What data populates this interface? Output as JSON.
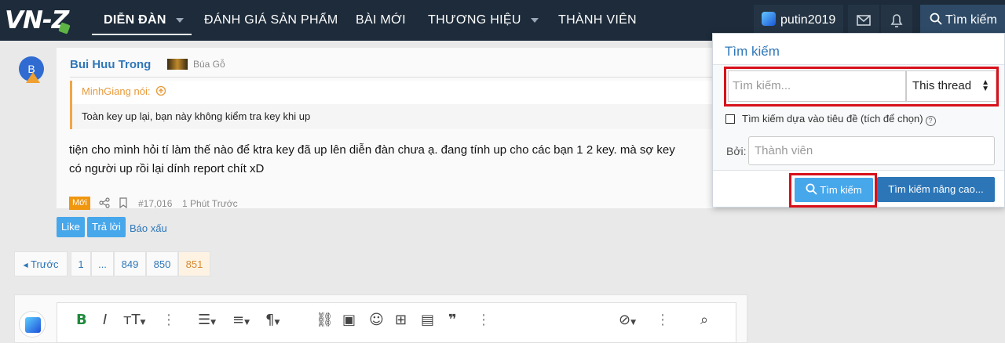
{
  "header": {
    "logo_text": "VN-Z",
    "nav": [
      {
        "label": "DIỄN ĐÀN"
      },
      {
        "label": "ĐÁNH GIÁ SẢN PHẨM"
      },
      {
        "label": "BÀI MỚI"
      },
      {
        "label": "THƯƠNG HIỆU"
      },
      {
        "label": "THÀNH VIÊN"
      }
    ],
    "username": "putin2019",
    "search_label": "Tìm kiếm"
  },
  "post": {
    "avatar_letter": "B",
    "author": "Bui Huu Trong",
    "rank": "Búa Gỗ",
    "quote_author": "MinhGiang nói:",
    "quote_text": "Toàn key up lại, bạn này không kiểm tra key khi up",
    "message_line1": "tiện cho mình hỏi tí làm thế nào để ktra key đã up lên diễn đàn chưa ạ. đang tính up cho các bạn 1 2 key. mà sợ key",
    "message_line2": "có người up rồi lại dính report chít xD",
    "new_badge": "Mới",
    "post_number": "#17,016",
    "time": "1 Phút Trước",
    "like_label": "Like",
    "reply_label": "Trả lời",
    "report_label": "Báo xấu"
  },
  "pagination": {
    "prev": "Trước",
    "pages": [
      "1",
      "...",
      "849",
      "850",
      "851"
    ],
    "current": "851"
  },
  "search_dropdown": {
    "title": "Tìm kiếm",
    "query_placeholder": "Tìm kiếm...",
    "scope": "This thread",
    "title_only_label": "Tìm kiếm dựa vào tiêu đề (tích để chọn)",
    "by_label": "Bởi:",
    "member_placeholder": "Thành viên",
    "submit_label": "Tìm kiếm",
    "advanced_label": "Tìm kiếm nâng cao..."
  },
  "colors": {
    "topbar": "#1d2b3a",
    "accent_blue": "#47a7eb",
    "link_blue": "#2f77b9",
    "quote_orange": "#e79a3a",
    "highlight_red": "#d7101a"
  }
}
